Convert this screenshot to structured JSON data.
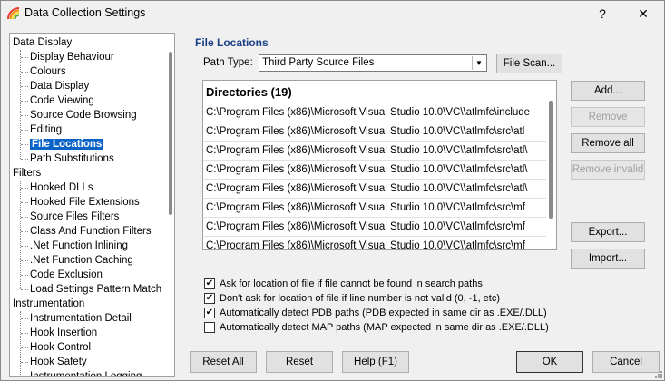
{
  "window": {
    "title": "Data Collection Settings",
    "help_glyph": "?",
    "close_glyph": "✕"
  },
  "tree": {
    "items": [
      {
        "label": "Data Display",
        "level": 0
      },
      {
        "label": "Display Behaviour",
        "level": 1
      },
      {
        "label": "Colours",
        "level": 1
      },
      {
        "label": "Data Display",
        "level": 1
      },
      {
        "label": "Code Viewing",
        "level": 1
      },
      {
        "label": "Source Code Browsing",
        "level": 1
      },
      {
        "label": "Editing",
        "level": 1
      },
      {
        "label": "File Locations",
        "level": 1,
        "selected": true
      },
      {
        "label": "Path Substitutions",
        "level": 1
      },
      {
        "label": "Filters",
        "level": 0
      },
      {
        "label": "Hooked DLLs",
        "level": 1
      },
      {
        "label": "Hooked File Extensions",
        "level": 1
      },
      {
        "label": "Source Files Filters",
        "level": 1
      },
      {
        "label": "Class And Function Filters",
        "level": 1
      },
      {
        "label": ".Net Function Inlining",
        "level": 1
      },
      {
        "label": ".Net Function Caching",
        "level": 1
      },
      {
        "label": "Code Exclusion",
        "level": 1
      },
      {
        "label": "Load Settings Pattern Match",
        "level": 1
      },
      {
        "label": "Instrumentation",
        "level": 0
      },
      {
        "label": "Instrumentation Detail",
        "level": 1
      },
      {
        "label": "Hook Insertion",
        "level": 1
      },
      {
        "label": "Hook Control",
        "level": 1
      },
      {
        "label": "Hook Safety",
        "level": 1
      },
      {
        "label": "Instrumentation Logging",
        "level": 1
      }
    ]
  },
  "section": {
    "title": "File Locations",
    "path_type_label": "Path Type:",
    "path_type_value": "Third Party Source Files",
    "file_scan_label": "File Scan..."
  },
  "directories": {
    "header": "Directories (19)",
    "rows": [
      "C:\\Program Files (x86)\\Microsoft Visual Studio 10.0\\VC\\\\atlmfc\\include",
      "C:\\Program Files (x86)\\Microsoft Visual Studio 10.0\\VC\\\\atlmfc\\src\\atl",
      "C:\\Program Files (x86)\\Microsoft Visual Studio 10.0\\VC\\\\atlmfc\\src\\atl\\",
      "C:\\Program Files (x86)\\Microsoft Visual Studio 10.0\\VC\\\\atlmfc\\src\\atl\\",
      "C:\\Program Files (x86)\\Microsoft Visual Studio 10.0\\VC\\\\atlmfc\\src\\atl\\",
      "C:\\Program Files (x86)\\Microsoft Visual Studio 10.0\\VC\\\\atlmfc\\src\\mf",
      "C:\\Program Files (x86)\\Microsoft Visual Studio 10.0\\VC\\\\atlmfc\\src\\mf",
      "C:\\Program Files (x86)\\Microsoft Visual Studio 10.0\\VC\\\\atlmfc\\src\\mf"
    ]
  },
  "side_buttons": {
    "add": "Add...",
    "remove": "Remove",
    "remove_all": "Remove all",
    "remove_invalid": "Remove invalid",
    "export": "Export...",
    "import": "Import..."
  },
  "options": [
    {
      "label": "Ask for location of file if file cannot be found in search paths",
      "checked": true
    },
    {
      "label": "Don't ask for location of file if line number is not valid (0, -1, etc)",
      "checked": true
    },
    {
      "label": "Automatically detect PDB paths (PDB expected in same dir as .EXE/.DLL)",
      "checked": true
    },
    {
      "label": "Automatically detect MAP paths (MAP expected in same dir as .EXE/.DLL)",
      "checked": false
    }
  ],
  "footer": {
    "reset_all": "Reset All",
    "reset": "Reset",
    "help": "Help (F1)",
    "ok": "OK",
    "cancel": "Cancel"
  },
  "check_glyph": "✔"
}
